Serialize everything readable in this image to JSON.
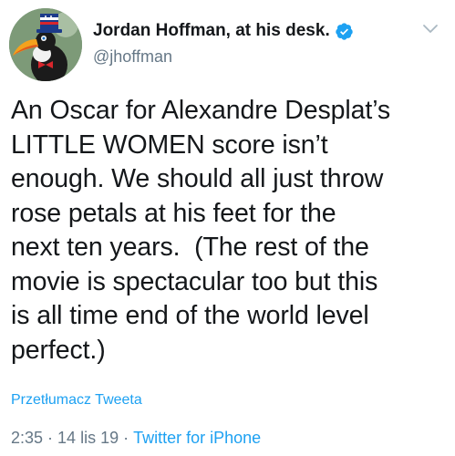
{
  "tweet": {
    "author": {
      "display_name": "Jordan Hoffman, at his desk.",
      "handle": "@jhoffman",
      "verified": true
    },
    "text": "An Oscar for Alexandre Desplat’s\nLITTLE WOMEN score isn’t\nenough. We should all just throw\nrose petals at his feet for the\nnext ten years.  (The rest of the\nmovie is spectacular too but this\nis all time end of the world level\nperfect.)",
    "translate_label": "Przetłumacz Tweeta",
    "time": "2:35",
    "date": "14 lis 19",
    "separator": "·",
    "source": "Twitter for iPhone"
  },
  "colors": {
    "link": "#1da1f2",
    "secondary_text": "#657786",
    "primary_text": "#14171a"
  },
  "icons": {
    "verified": "verified-badge-icon",
    "menu": "chevron-down-icon"
  }
}
